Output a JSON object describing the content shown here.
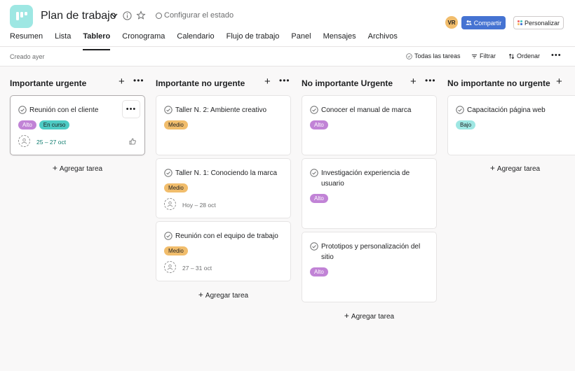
{
  "project": {
    "title": "Plan de trabajo",
    "status_label": "Configurar el estado"
  },
  "header": {
    "avatar_initials": "VR",
    "share_label": "Compartir",
    "customize_label": "Personalizar"
  },
  "tabs": [
    {
      "label": "Resumen"
    },
    {
      "label": "Lista"
    },
    {
      "label": "Tablero"
    },
    {
      "label": "Cronograma"
    },
    {
      "label": "Calendario"
    },
    {
      "label": "Flujo de trabajo"
    },
    {
      "label": "Panel"
    },
    {
      "label": "Mensajes"
    },
    {
      "label": "Archivos"
    }
  ],
  "active_tab": "Tablero",
  "toolbar": {
    "created": "Creado ayer",
    "all_tasks": "Todas las tareas",
    "filter": "Filtrar",
    "sort": "Ordenar"
  },
  "board": {
    "add_task_label": "Agregar tarea",
    "columns": [
      {
        "title": "Importante urgente",
        "cards": [
          {
            "title": "Reunión con el cliente",
            "tags": [
              "Alto",
              "En curso"
            ],
            "date": "25 – 27 oct"
          }
        ]
      },
      {
        "title": "Importante no urgente",
        "cards": [
          {
            "title": "Taller N. 2: Ambiente creativo",
            "tags": [
              "Medio"
            ]
          },
          {
            "title": "Taller N. 1: Conociendo la marca",
            "tags": [
              "Medio"
            ],
            "date": "Hoy – 28 oct"
          },
          {
            "title": "Reunión con el equipo de trabajo",
            "tags": [
              "Medio"
            ],
            "date": "27 – 31 oct"
          }
        ]
      },
      {
        "title": "No importante Urgente",
        "cards": [
          {
            "title": "Conocer el manual de marca",
            "tags": [
              "Alto"
            ]
          },
          {
            "title": "Investigación experiencia de usuario",
            "tags": [
              "Alto"
            ]
          },
          {
            "title": "Prototipos y personalización del sitio",
            "tags": [
              "Alto"
            ]
          }
        ]
      },
      {
        "title": "No importante no urgente",
        "cards": [
          {
            "title": "Capacitación página web",
            "tags": [
              "Bajo"
            ]
          }
        ]
      }
    ]
  },
  "colors": {
    "logo_bg": "#9ee7e3",
    "share_bg": "#4573d2",
    "tag_alto": "#c183d6",
    "tag_medio": "#f1bd6c",
    "tag_bajo": "#9ee7e3",
    "tag_en_curso": "#4ecbc4",
    "date_green": "#0e7c6e"
  },
  "icons": [
    "board-logo-icon",
    "chevron-down-icon",
    "info-icon",
    "star-icon",
    "check-circle-icon",
    "plus-icon",
    "more-icon",
    "user-icon",
    "like-icon",
    "filter-icon",
    "sort-icon",
    "people-icon"
  ]
}
